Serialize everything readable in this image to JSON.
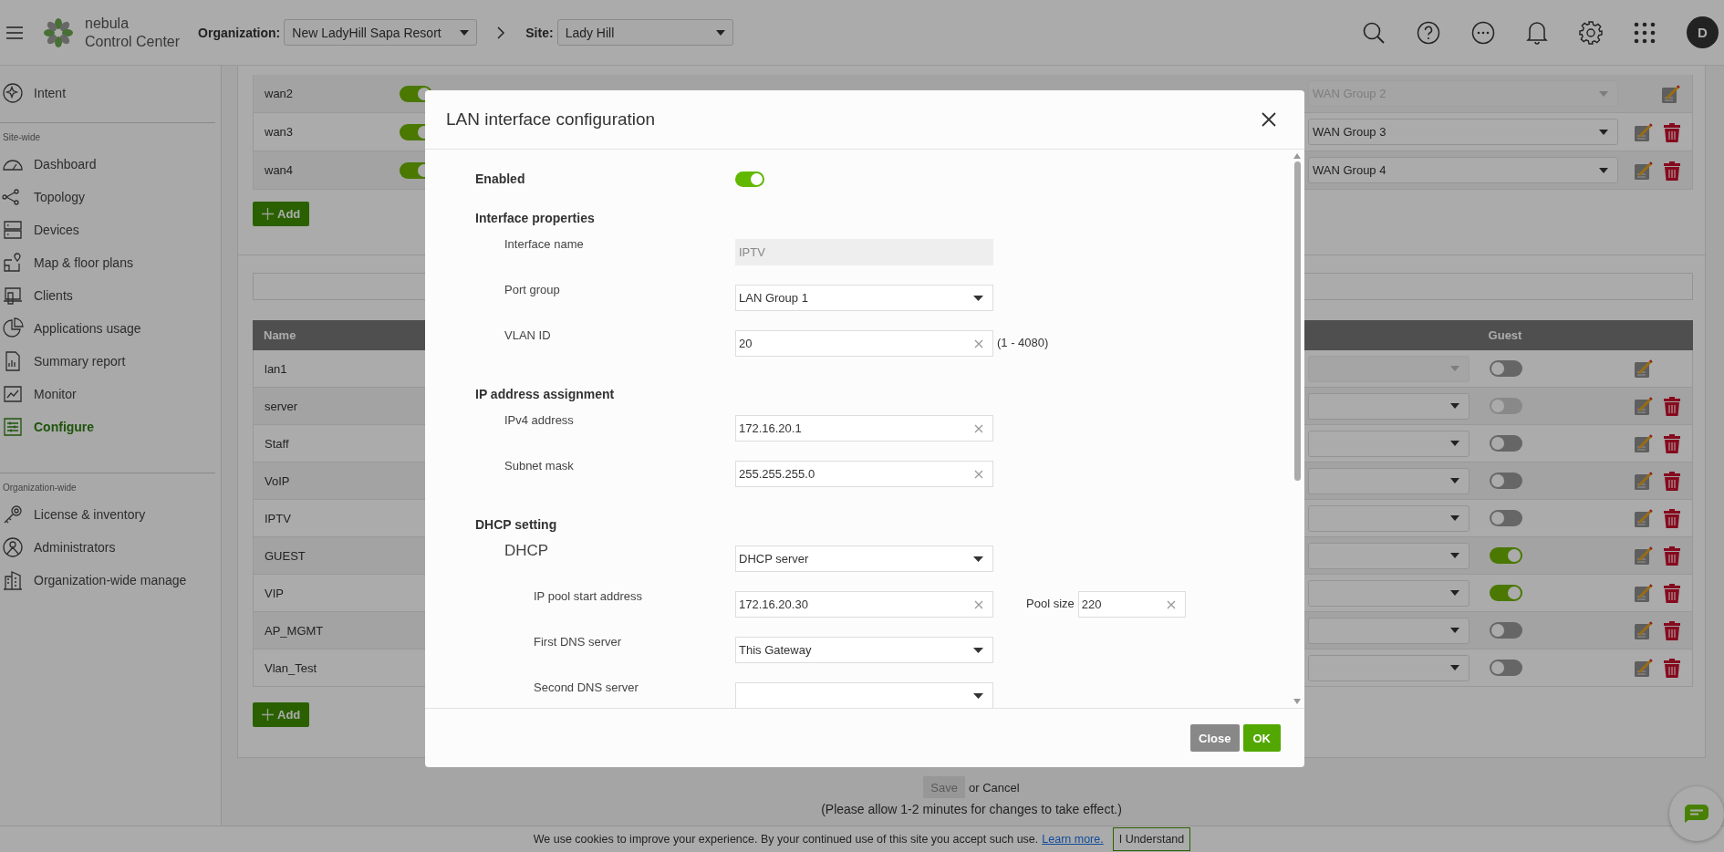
{
  "header": {
    "app_name": "nebula",
    "app_subtitle": "Control Center",
    "organization": {
      "label": "Organization:",
      "value": "New LadyHill Sapa Resort"
    },
    "site": {
      "label": "Site:",
      "value": "Lady Hill"
    },
    "avatar": "D"
  },
  "sidebar": {
    "top_items": [
      {
        "label": "Intent",
        "selected": false
      }
    ],
    "groups": [
      {
        "title": "Site-wide",
        "items": [
          {
            "label": "Dashboard",
            "selected": false
          },
          {
            "label": "Topology",
            "selected": false
          },
          {
            "label": "Devices",
            "selected": false
          },
          {
            "label": "Map & floor plans",
            "selected": false
          },
          {
            "label": "Clients",
            "selected": false
          },
          {
            "label": "Applications usage",
            "selected": false
          },
          {
            "label": "Summary report",
            "selected": false
          },
          {
            "label": "Monitor",
            "selected": false
          },
          {
            "label": "Configure",
            "selected": true
          }
        ]
      },
      {
        "title": "Organization-wide",
        "items": [
          {
            "label": "License & inventory",
            "selected": false
          },
          {
            "label": "Administrators",
            "selected": false
          },
          {
            "label": "Organization-wide manage",
            "selected": false
          }
        ]
      }
    ]
  },
  "wan_table": {
    "rows": [
      {
        "name": "wan2",
        "enabled": true,
        "group": "WAN Group 2",
        "group_disabled": true,
        "deletable": false
      },
      {
        "name": "wan3",
        "enabled": true,
        "group": "WAN Group 3",
        "group_disabled": false,
        "deletable": true
      },
      {
        "name": "wan4",
        "enabled": true,
        "group": "WAN Group 4",
        "group_disabled": false,
        "deletable": true
      }
    ],
    "add_button": "Add"
  },
  "lan_table": {
    "columns": {
      "name": "Name",
      "guest": "Guest"
    },
    "rows": [
      {
        "name": "lan1",
        "select_disabled": true,
        "guest": false,
        "guest_disabled": false,
        "deletable": false
      },
      {
        "name": "server",
        "select_disabled": false,
        "guest": false,
        "guest_disabled": true,
        "deletable": true
      },
      {
        "name": "Staff",
        "select_disabled": false,
        "guest": false,
        "guest_disabled": false,
        "deletable": true
      },
      {
        "name": "VoIP",
        "select_disabled": false,
        "guest": false,
        "guest_disabled": false,
        "deletable": true
      },
      {
        "name": "IPTV",
        "select_disabled": false,
        "guest": false,
        "guest_disabled": false,
        "deletable": true
      },
      {
        "name": "GUEST",
        "select_disabled": false,
        "guest": true,
        "guest_disabled": false,
        "deletable": true
      },
      {
        "name": "VIP",
        "select_disabled": false,
        "guest": true,
        "guest_disabled": false,
        "deletable": true
      },
      {
        "name": "AP_MGMT",
        "select_disabled": false,
        "guest": false,
        "guest_disabled": false,
        "deletable": true
      },
      {
        "name": "Vlan_Test",
        "select_disabled": false,
        "guest": false,
        "guest_disabled": false,
        "deletable": true
      }
    ],
    "add_button": "Add"
  },
  "page_footer": {
    "save": "Save",
    "save_disabled": true,
    "cancel": "or Cancel",
    "note": "(Please allow 1-2 minutes for changes to take effect.)"
  },
  "cookie_bar": {
    "text": "We use cookies to improve your experience. By your continued use of this site you accept such use.",
    "link": "Learn more.",
    "button": "I Understand"
  },
  "modal": {
    "title": "LAN interface configuration",
    "enabled": {
      "label": "Enabled",
      "on": true
    },
    "sections": [
      {
        "title": "Interface properties",
        "fields": [
          {
            "kind": "readonly",
            "label": "Interface name",
            "value": "IPTV"
          },
          {
            "kind": "select",
            "label": "Port group",
            "value": "LAN Group 1"
          },
          {
            "kind": "input",
            "label": "VLAN ID",
            "value": "20",
            "hint": "(1 - 4080)"
          }
        ]
      },
      {
        "title": "IP address assignment",
        "fields": [
          {
            "kind": "input",
            "label": "IPv4 address",
            "value": "172.16.20.1"
          },
          {
            "kind": "input",
            "label": "Subnet mask",
            "value": "255.255.255.0"
          }
        ]
      },
      {
        "title": "DHCP setting",
        "fields": [
          {
            "kind": "select",
            "label": "DHCP",
            "value": "DHCP server",
            "children": [
              {
                "kind": "input",
                "label": "IP pool start address",
                "value": "172.16.20.30",
                "extra": {
                  "label": "Pool size",
                  "value": "220"
                }
              },
              {
                "kind": "select",
                "label": "First DNS server",
                "value": "This Gateway"
              },
              {
                "kind": "select",
                "label": "Second DNS server"
              }
            ]
          }
        ]
      }
    ],
    "buttons": {
      "close": "Close",
      "ok": "OK"
    }
  }
}
